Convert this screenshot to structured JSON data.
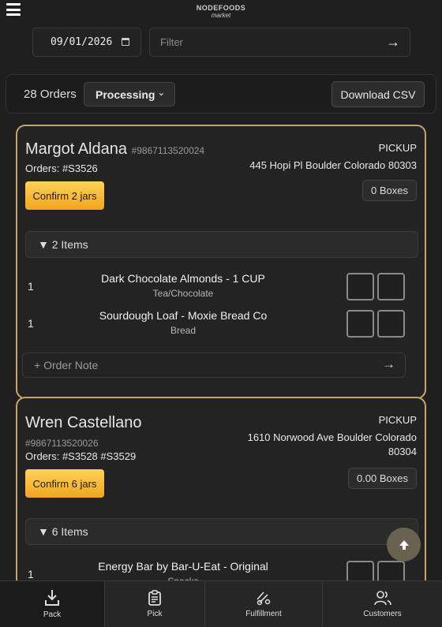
{
  "app": {
    "logo_line1": "NODEFOODS",
    "logo_line2": "market"
  },
  "filters": {
    "date_value": "09/01/2026",
    "filter_placeholder": "Filter"
  },
  "toolbar": {
    "orders_count": "28 Orders",
    "status": "Processing",
    "download_label": "Download CSV"
  },
  "orders": [
    {
      "name": "Margot Aldana",
      "customer_id": "#9867113520024",
      "orders_label": "Orders: #S3526",
      "confirm_label": "Confirm 2 jars",
      "method": "PICKUP",
      "address": "445 Hopi Pl Boulder Colorado 80303",
      "boxes_label": "0 Boxes",
      "items_label": "▼ 2 Items",
      "items": [
        {
          "qty": "1",
          "name": "Dark Chocolate Almonds - 1 CUP",
          "category": "Tea/Chocolate"
        },
        {
          "qty": "1",
          "name": "Sourdough Loaf - Moxie Bread Co",
          "category": "Bread"
        }
      ],
      "note_label": "+ Order Note"
    },
    {
      "name": "Wren Castellano",
      "customer_id": "#9867113520026",
      "orders_label": "Orders: #S3528 #S3529",
      "confirm_label": "Confirm 6 jars",
      "method": "PICKUP",
      "address_line1": "1610 Norwood Ave Boulder Colorado",
      "address_line2": "80304",
      "boxes_label": "0.00 Boxes",
      "items_label": "▼ 6 Items",
      "items": [
        {
          "qty": "1",
          "name": "Energy Bar by Bar-U-Eat - Original",
          "category": "Snacks"
        }
      ]
    }
  ],
  "nav": {
    "pack": "Pack",
    "pick": "Pick",
    "fulfillment": "Fulfillment",
    "customers": "Customers"
  },
  "colors": {
    "accent": "#c9a46a",
    "confirm": "#f7b733",
    "background": "#1f1f1f"
  }
}
